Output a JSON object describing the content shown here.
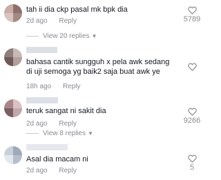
{
  "comments": [
    {
      "text": "tah ii dia ckp pasal mk bpk dia",
      "time": "2d ago",
      "reply_label": "Reply",
      "replies_label": "View 20 replies",
      "likes": "5789",
      "avatar_colors": [
        "#c9aca7",
        "#8e6f69",
        "#d8c4c0",
        "#a48a84"
      ]
    },
    {
      "text": "bahasa cantik sungguh x pela awk sedang di uji semoga yg baik2 saja buat awk ye",
      "time": "18h ago",
      "reply_label": "Reply",
      "replies_label": "",
      "likes": "",
      "avatar_colors": [
        "#8f7f7c",
        "#c7b9b6",
        "#6e5a57",
        "#b39f9b"
      ]
    },
    {
      "text": "teruk sangat ni sakit dia",
      "time": "2d ago",
      "reply_label": "Reply",
      "replies_label": "View 8 replies",
      "likes": "9266",
      "avatar_colors": [
        "#a8868a",
        "#d9c2c4",
        "#7a5f63",
        "#c4a7aa"
      ]
    },
    {
      "text": "Asal dia macam ni",
      "time": "2d ago",
      "reply_label": "Reply",
      "replies_label": "",
      "likes": "5",
      "avatar_colors": [
        "#c9d0da",
        "#9fa9b8",
        "#e3e7ee",
        "#b6bfcc"
      ]
    }
  ],
  "icons": {
    "like": "heart-outline-icon",
    "expand": "chevron-down-icon"
  },
  "colors": {
    "text": "#161823",
    "secondary": "#8a8b91"
  }
}
